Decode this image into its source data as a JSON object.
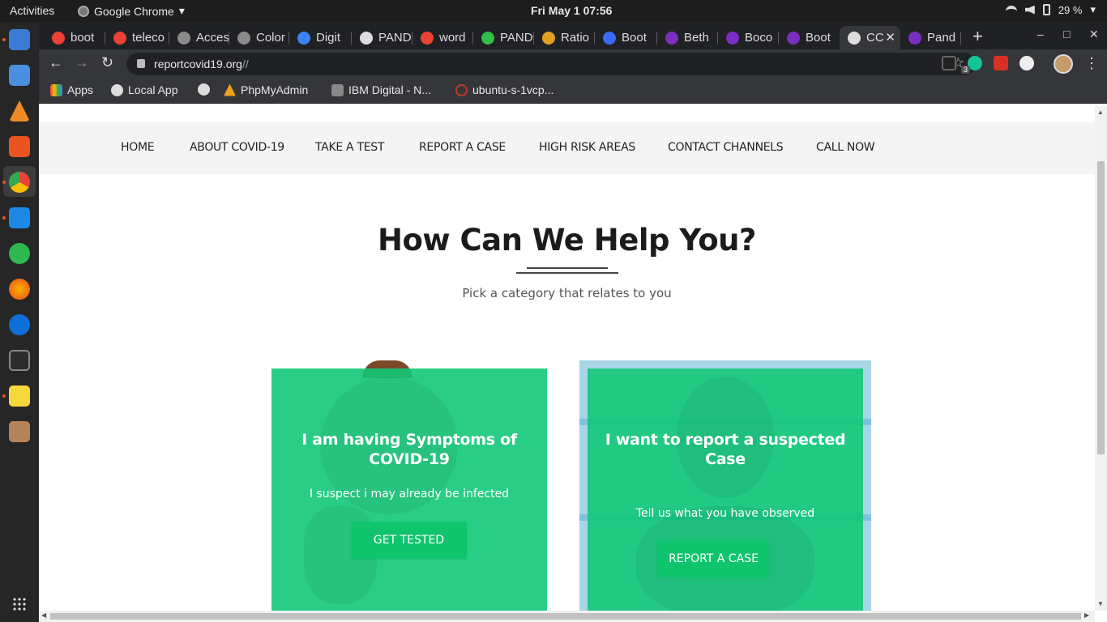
{
  "system": {
    "activities": "Activities",
    "app_name": "Google Chrome",
    "clock": "Fri May 1  07:56",
    "battery": "29 %"
  },
  "browser": {
    "tabs": [
      {
        "label": "boot",
        "color": "#ea4335"
      },
      {
        "label": "teleco",
        "color": "#ea4335"
      },
      {
        "label": "Acces",
        "color": "#8a8a8a"
      },
      {
        "label": "Color",
        "color": "#8a8a8a"
      },
      {
        "label": "Digit",
        "color": "#3b82f6"
      },
      {
        "label": "PAND",
        "color": "#dddddd"
      },
      {
        "label": "word",
        "color": "#ea4335"
      },
      {
        "label": "PAND",
        "color": "#2fbf4a"
      },
      {
        "label": "Ratio",
        "color": "#e0a020"
      },
      {
        "label": "Boot",
        "color": "#3b6bf6"
      },
      {
        "label": "Beth",
        "color": "#7a2fc0"
      },
      {
        "label": "Boco",
        "color": "#7a2fc0"
      },
      {
        "label": "Boot",
        "color": "#7a2fc0"
      },
      {
        "label": "CC",
        "color": "#dddddd"
      },
      {
        "label": "Pand",
        "color": "#7a2fc0"
      }
    ],
    "url_main": "reportcovid19.org",
    "url_dim": "//",
    "ext_badge": "3",
    "bookmarks": [
      "Apps",
      "Local App",
      "",
      "PhpMyAdmin",
      "IBM Digital - N...",
      "ubuntu-s-1vcp..."
    ]
  },
  "page": {
    "nav": [
      "HOME",
      "ABOUT COVID-19",
      "TAKE A TEST",
      "REPORT A CASE",
      "HIGH RISK AREAS",
      "CONTACT CHANNELS",
      "CALL NOW"
    ],
    "heading": "How Can We Help You?",
    "subheading": "Pick a category that relates to you",
    "cards": [
      {
        "title": "I am having Symptoms of COVID-19",
        "text": "I suspect i may already be infected",
        "button": "GET TESTED"
      },
      {
        "title": "I want to report a suspected Case",
        "text": "Tell us what you have observed",
        "button": "REPORT A CASE"
      }
    ]
  }
}
